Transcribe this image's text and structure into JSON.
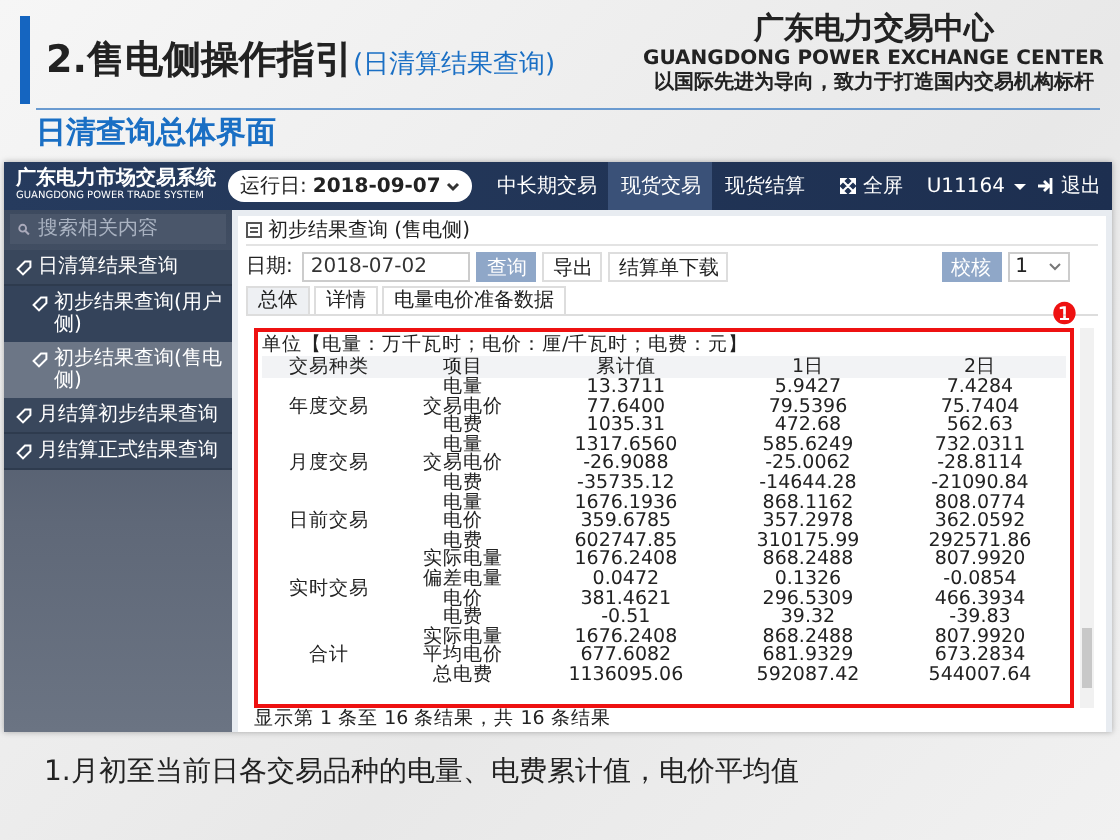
{
  "slide": {
    "title": "2.售电侧操作指引",
    "title_note": "(日清算结果查询)",
    "org_name": "广东电力交易中心",
    "org_name_en": "GUANGDONG POWER EXCHANGE CENTER",
    "slogan": "以国际先进为导向，致力于打造国内交易机构标杆",
    "subtitle": "日清查询总体界面",
    "caption": "1.月初至当前日各交易品种的电量、电费累计值，电价平均值"
  },
  "app": {
    "logo": "广东电力市场交易系统",
    "logo_en": "GUANGDONG POWER TRADE SYSTEM",
    "run_day_label": "运行日:",
    "run_day": "2018-09-07",
    "nav": [
      {
        "label": "中长期交易",
        "selected": false
      },
      {
        "label": "现货交易",
        "selected": true
      },
      {
        "label": "现货结算",
        "selected": false
      }
    ],
    "fullscreen": "全屏",
    "user": "U11164",
    "logout": "退出"
  },
  "sidebar": {
    "search_placeholder": "搜索相关内容",
    "items": [
      {
        "label": "日清算结果查询",
        "children": [
          {
            "label": "初步结果查询(用户侧)",
            "selected": false
          },
          {
            "label": "初步结果查询(售电侧)",
            "selected": true
          }
        ]
      },
      {
        "label": "月结算初步结果查询"
      },
      {
        "label": "月结算正式结果查询"
      }
    ]
  },
  "panel": {
    "title": "初步结果查询 (售电侧)",
    "date_label": "日期:",
    "date": "2018-07-02",
    "buttons": [
      {
        "label": "查询",
        "kind": "primary"
      },
      {
        "label": "导出",
        "kind": "default"
      },
      {
        "label": "结算单下载",
        "kind": "default"
      }
    ],
    "check_button": "校核",
    "version": "1",
    "tabs": [
      {
        "label": "总体",
        "selected": true
      },
      {
        "label": "详情",
        "selected": false
      },
      {
        "label": "电量电价准备数据",
        "selected": false
      }
    ],
    "unit": "单位【电量：万千瓦时；电价：厘/千瓦时；电费：元】",
    "columns": [
      "交易种类",
      "项目",
      "累计值",
      "1日",
      "2日"
    ],
    "groups": [
      {
        "category": "年度交易",
        "rows": [
          [
            "电量",
            "13.3711",
            "5.9427",
            "7.4284"
          ],
          [
            "交易电价",
            "77.6400",
            "79.5396",
            "75.7404"
          ],
          [
            "电费",
            "1035.31",
            "472.68",
            "562.63"
          ]
        ]
      },
      {
        "category": "月度交易",
        "rows": [
          [
            "电量",
            "1317.6560",
            "585.6249",
            "732.0311"
          ],
          [
            "交易电价",
            "-26.9088",
            "-25.0062",
            "-28.8114"
          ],
          [
            "电费",
            "-35735.12",
            "-14644.28",
            "-21090.84"
          ]
        ]
      },
      {
        "category": "日前交易",
        "rows": [
          [
            "电量",
            "1676.1936",
            "868.1162",
            "808.0774"
          ],
          [
            "电价",
            "359.6785",
            "357.2978",
            "362.0592"
          ],
          [
            "电费",
            "602747.85",
            "310175.99",
            "292571.86"
          ]
        ]
      },
      {
        "category": "实时交易",
        "rows": [
          [
            "实际电量",
            "1676.2408",
            "868.2488",
            "807.9920"
          ],
          [
            "偏差电量",
            "0.0472",
            "0.1326",
            "-0.0854"
          ],
          [
            "电价",
            "381.4621",
            "296.5309",
            "466.3934"
          ],
          [
            "电费",
            "-0.51",
            "39.32",
            "-39.83"
          ]
        ]
      },
      {
        "category": "合计",
        "rows": [
          [
            "实际电量",
            "1676.2408",
            "868.2488",
            "807.9920"
          ],
          [
            "平均电价",
            "677.6082",
            "681.9329",
            "673.2834"
          ],
          [
            "总电费",
            "1136095.06",
            "592087.42",
            "544007.64"
          ]
        ]
      }
    ],
    "footer": "显示第 1 条至 16 条结果，共 16 条结果",
    "annotation": "❶"
  }
}
